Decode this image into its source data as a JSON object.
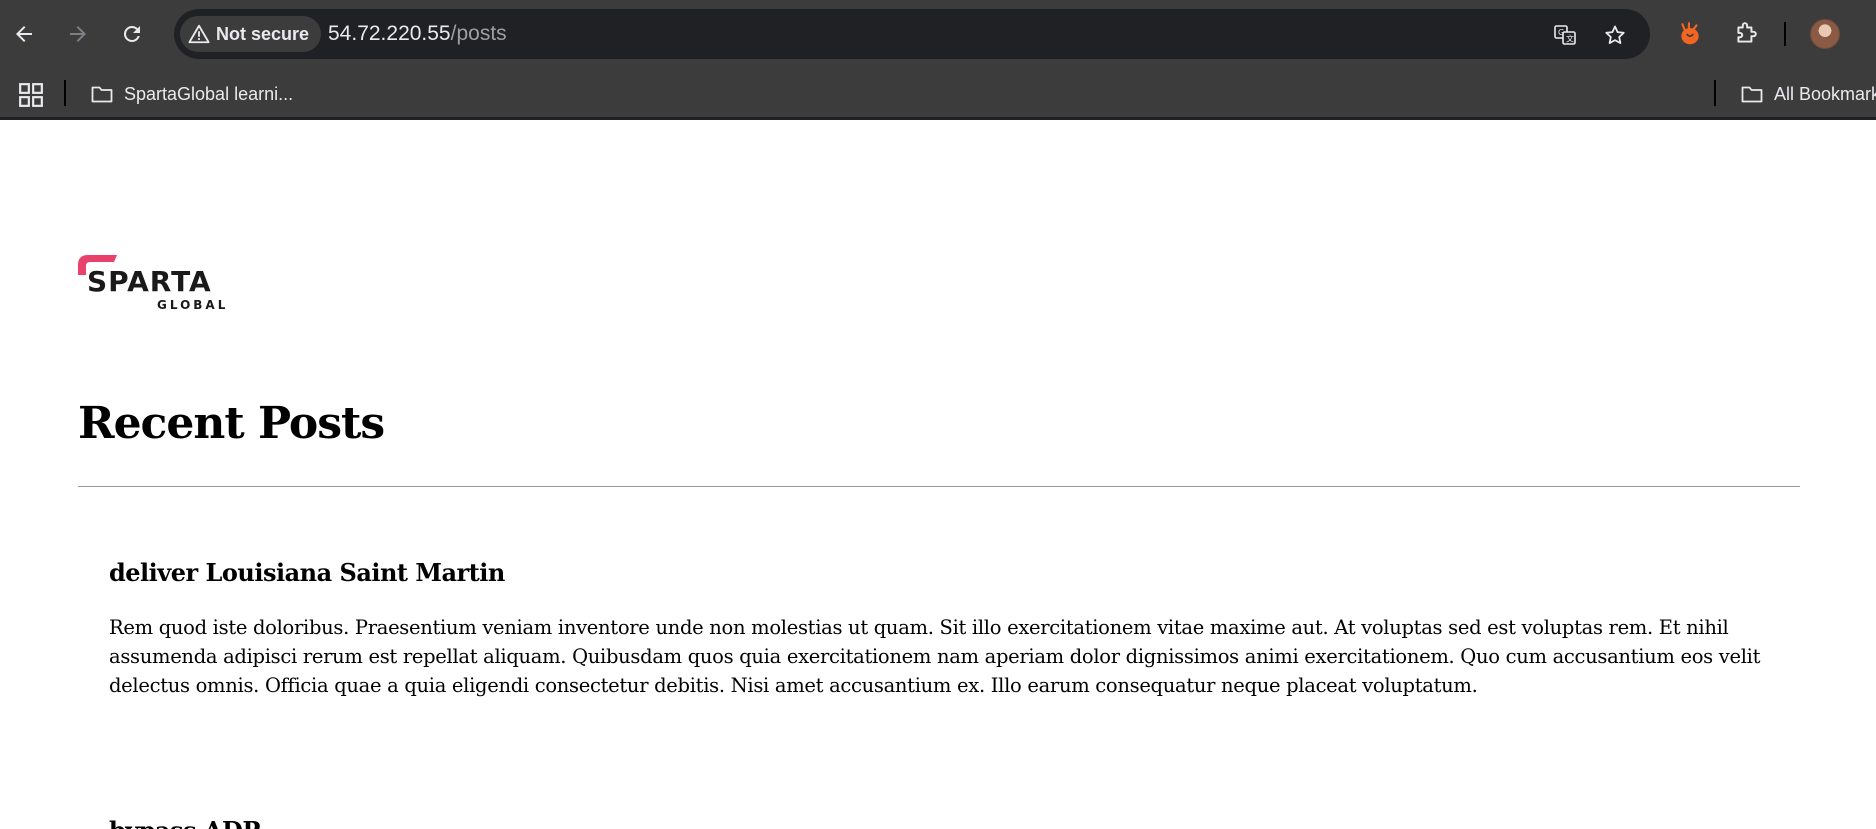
{
  "browser": {
    "security_label": "Not secure",
    "url_host": "54.72.220.55",
    "url_path": "/posts",
    "icons": {
      "back": "back-arrow-icon",
      "forward": "forward-arrow-icon",
      "reload": "reload-icon",
      "warning": "warning-triangle-icon",
      "translate": "translate-icon",
      "bookmark_star": "star-icon",
      "extension_1": "orange-extension-icon",
      "extensions": "puzzle-icon",
      "profile": "avatar"
    }
  },
  "bookmarks_bar": {
    "apps_icon": "apps-grid-icon",
    "items": [
      {
        "label": "SpartaGlobal learni...",
        "icon": "folder-icon"
      }
    ],
    "all_bookmarks": {
      "label": "All Bookmarks",
      "icon": "folder-icon"
    }
  },
  "page": {
    "logo_text": "SPARTA",
    "logo_subtext": "GLOBAL",
    "heading": "Recent Posts",
    "posts": [
      {
        "title": "deliver Louisiana Saint Martin",
        "body": "Rem quod iste doloribus. Praesentium veniam inventore unde non molestias ut quam. Sit illo exercitationem vitae maxime aut. At voluptas sed est voluptas rem. Et nihil assumenda adipisci rerum est repellat aliquam. Quibusdam quos quia exercitationem nam aperiam dolor dignissimos animi exercitationem. Quo cum accusantium eos velit delectus omnis. Officia quae a quia eligendi consectetur debitis. Nisi amet accusantium ex. Illo earum consequatur neque placeat voluptatum."
      },
      {
        "title": "bypass ADP",
        "body": ""
      }
    ]
  },
  "colors": {
    "chrome_bg": "#3c3c3c",
    "omnibox_bg": "#202124",
    "brand_accent": "#e8416b",
    "extension_orange": "#f26522"
  }
}
